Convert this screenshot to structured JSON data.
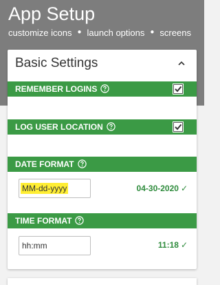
{
  "app": {
    "title": "App Setup",
    "nav": [
      "customize icons",
      "launch options",
      "screens"
    ],
    "nav_separator": "●"
  },
  "colors": {
    "header_bg": "#7d7d7d",
    "accent_green": "#3b9a45",
    "preview_green": "#2e8b3c",
    "highlight_yellow": "#ffee33"
  },
  "card": {
    "title": "Basic Settings",
    "collapse_icon": "chevron-up-icon",
    "sections": {
      "remember_logins": {
        "label": "REMEMBER LOGINS",
        "checked": true
      },
      "log_user_location": {
        "label": "LOG USER LOCATION",
        "checked": true
      },
      "date_format": {
        "label": "DATE FORMAT",
        "value": "MM-dd-yyyy",
        "preview": "04-30-2020",
        "check": "✓"
      },
      "time_format": {
        "label": "TIME FORMAT",
        "value": "hh:mm",
        "preview": "11:18",
        "check": "✓"
      }
    }
  }
}
